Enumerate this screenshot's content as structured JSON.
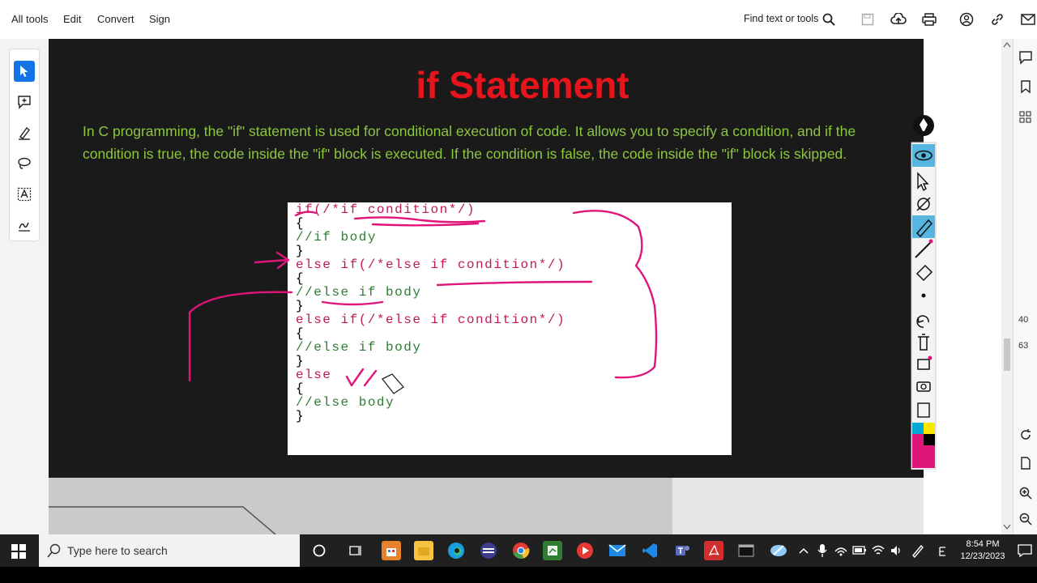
{
  "toolbar": {
    "menu": [
      "All tools",
      "Edit",
      "Convert",
      "Sign"
    ],
    "find_label": "Find text or tools"
  },
  "slide": {
    "title": "if Statement",
    "paragraph": "In C programming, the \"if\" statement is used for conditional execution of code. It allows you to specify a condition, and if the condition is true, the code inside the \"if\" block is executed. If the condition is false, the code inside the \"if\" block is skipped.",
    "code_lines": [
      {
        "text": "if(/*if condition*/)",
        "kind": "kw"
      },
      {
        "text": "{",
        "kind": "plain"
      },
      {
        "text": "//if body",
        "kind": "cm"
      },
      {
        "text": "}",
        "kind": "plain"
      },
      {
        "text": "else if(/*else if condition*/)",
        "kind": "kw"
      },
      {
        "text": "{",
        "kind": "plain"
      },
      {
        "text": "//else if body",
        "kind": "cm"
      },
      {
        "text": "}",
        "kind": "plain"
      },
      {
        "text": "else if(/*else if condition*/)",
        "kind": "kw"
      },
      {
        "text": "{",
        "kind": "plain"
      },
      {
        "text": "//else if body",
        "kind": "cm"
      },
      {
        "text": "}",
        "kind": "plain"
      },
      {
        "text": "else",
        "kind": "kw"
      },
      {
        "text": "{",
        "kind": "plain"
      },
      {
        "text": "//else body",
        "kind": "cm"
      },
      {
        "text": "}",
        "kind": "plain"
      }
    ]
  },
  "right_strip": {
    "zoom_a": "40",
    "zoom_b": "63"
  },
  "taskbar": {
    "search_placeholder": "Type here to search",
    "time": "8:54 PM",
    "date": "12/23/2023"
  },
  "colors": {
    "title": "#e8141b",
    "paragraph": "#8dc63f",
    "ink": "#e0157a",
    "keyword": "#c2185b",
    "comment": "#2e7d32",
    "toolbar_active": "#1473e6"
  }
}
